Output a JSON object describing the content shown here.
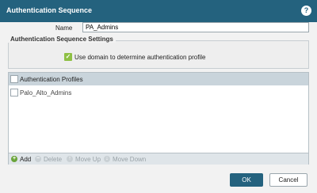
{
  "dialog": {
    "title": "Authentication Sequence",
    "help_icon": "?",
    "accent_color": "#24627e"
  },
  "form": {
    "name_label": "Name",
    "name_value": "PA_Admins"
  },
  "settings": {
    "title": "Authentication Sequence Settings",
    "use_domain_label": "Use domain to determine authentication profile",
    "use_domain_checked": true
  },
  "profiles": {
    "header": "Authentication Profiles",
    "rows": [
      {
        "label": "Palo_Alto_Admins"
      }
    ]
  },
  "toolbar": {
    "add": "Add",
    "delete": "Delete",
    "move_up": "Move Up",
    "move_down": "Move Down"
  },
  "buttons": {
    "ok": "OK",
    "cancel": "Cancel"
  }
}
